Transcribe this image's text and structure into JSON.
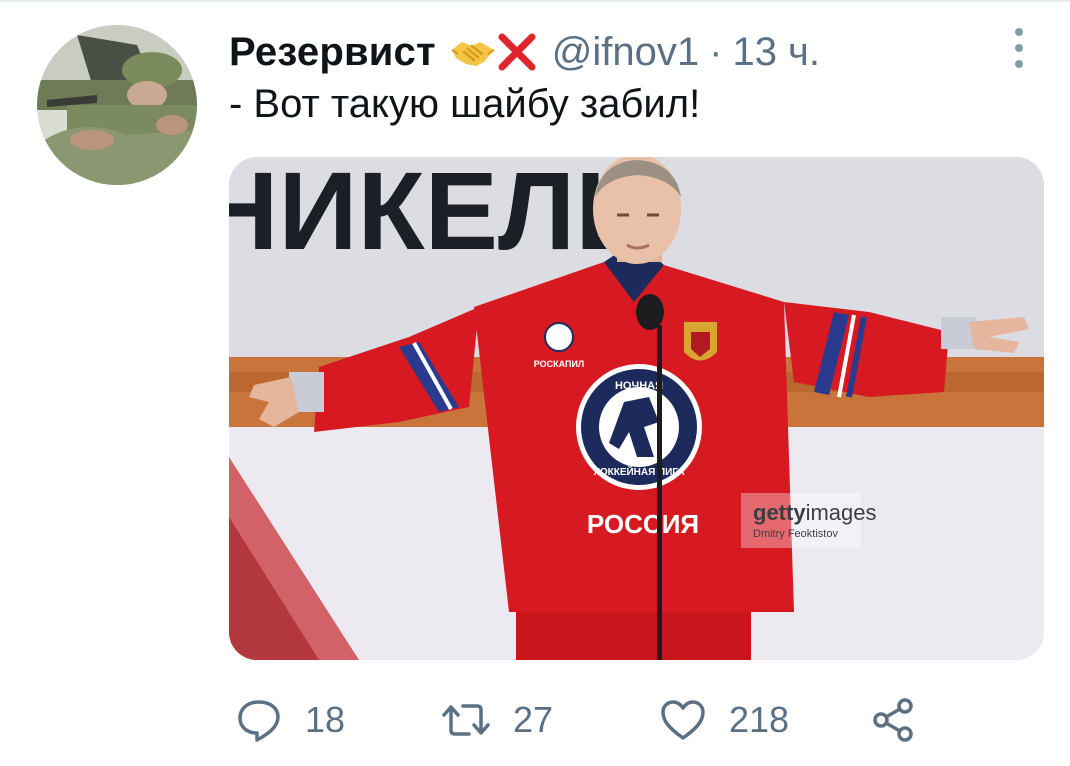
{
  "tweet": {
    "display_name": "Резервист",
    "badges": [
      "handshake-emoji",
      "red-cross-mark-emoji"
    ],
    "handle": "@ifnov1",
    "separator": "·",
    "time": "13 ч.",
    "text": "- Вот такую шайбу забил!"
  },
  "media": {
    "banner_text": "НИКЕЛЬ",
    "jersey_text": "РОССИЯ",
    "logo_text_top": "НОЧНАЯ",
    "logo_text_bottom": "ХОККЕЙНАЯ ЛИГА",
    "patch_text": "РОСКАПИЛ",
    "watermark_brand_bold": "getty",
    "watermark_brand": "images",
    "watermark_credit": "Dmitry Feoktistov"
  },
  "actions": {
    "reply_count": "18",
    "retweet_count": "27",
    "like_count": "218"
  },
  "colors": {
    "text_primary": "#0f1419",
    "text_secondary": "#5b7083",
    "jersey_red": "#d71a21",
    "cross_red": "#e0262b",
    "handshake_yellow": "#f4c542"
  }
}
